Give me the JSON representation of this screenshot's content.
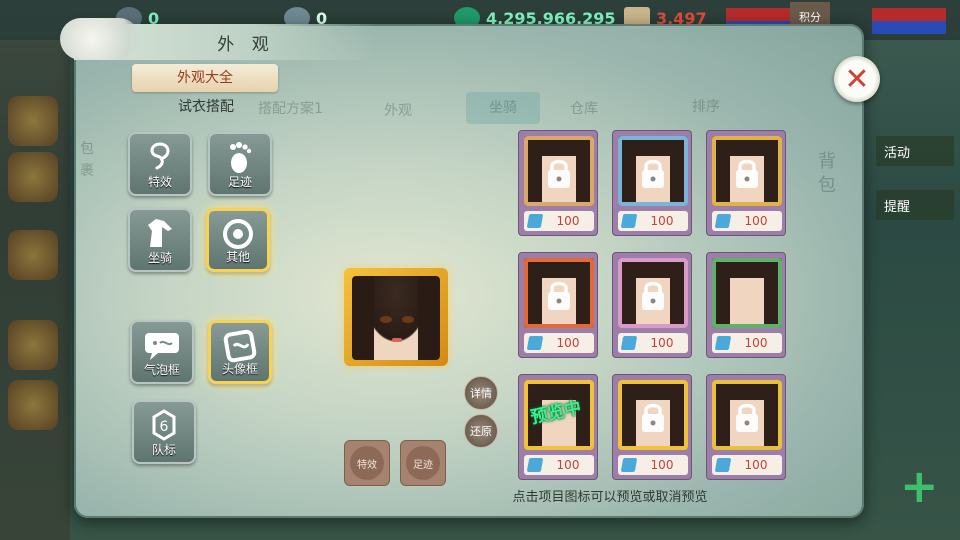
{
  "hud": {
    "silver": "0",
    "gems": "0",
    "coins": "4,295,966,295",
    "tokens": "3,497",
    "right_badge": "积分"
  },
  "right_side": [
    "活动",
    "提醒"
  ],
  "panel": {
    "title": "外 观",
    "tab_main": "外观大全",
    "tab_sub": "试衣搭配",
    "faded_tabs": [
      "搭配方案1",
      "外观",
      "坐骑",
      "仓库",
      "排序"
    ],
    "faded_side_left": "包裹",
    "faded_side_right": "背包",
    "close": "✕"
  },
  "categories": [
    {
      "label": "特效",
      "icon": "swirl-icon",
      "selected": false
    },
    {
      "label": "足迹",
      "icon": "footprint-icon",
      "selected": false
    },
    {
      "label": "坐骑",
      "icon": "horse-icon",
      "selected": false
    },
    {
      "label": "其他",
      "icon": "orb-icon",
      "selected": true
    },
    {
      "label": "气泡框",
      "icon": "speech-bubble-icon",
      "selected": false
    },
    {
      "label": "头像框",
      "icon": "frame-icon",
      "selected": true
    },
    {
      "label": "队标",
      "icon": "team-emblem-icon",
      "selected": false
    }
  ],
  "preview": {
    "detail_button": "详情",
    "restore_button": "还原",
    "effect_button": "特效",
    "footprint_button": "足迹"
  },
  "items": [
    {
      "price": "100",
      "locked": true,
      "frame": "#d9a86a"
    },
    {
      "price": "100",
      "locked": true,
      "frame": "#7ab5d9"
    },
    {
      "price": "100",
      "locked": true,
      "frame": "#e0b24a"
    },
    {
      "price": "100",
      "locked": true,
      "frame": "#e06a3a"
    },
    {
      "price": "100",
      "locked": true,
      "frame": "#d99ac7"
    },
    {
      "price": "100",
      "locked": false,
      "frame": "#5fb06a"
    },
    {
      "price": "100",
      "locked": false,
      "frame": "#f0c23a",
      "badge": "预览中"
    },
    {
      "price": "100",
      "locked": true,
      "frame": "#f0c23a"
    },
    {
      "price": "100",
      "locked": true,
      "frame": "#e8c040"
    }
  ],
  "hint": "点击项目图标可以预览或取消预览",
  "colors": {
    "accent_gold": "#f6d256",
    "price_red": "#c4423a",
    "badge_green": "#3df28d"
  }
}
